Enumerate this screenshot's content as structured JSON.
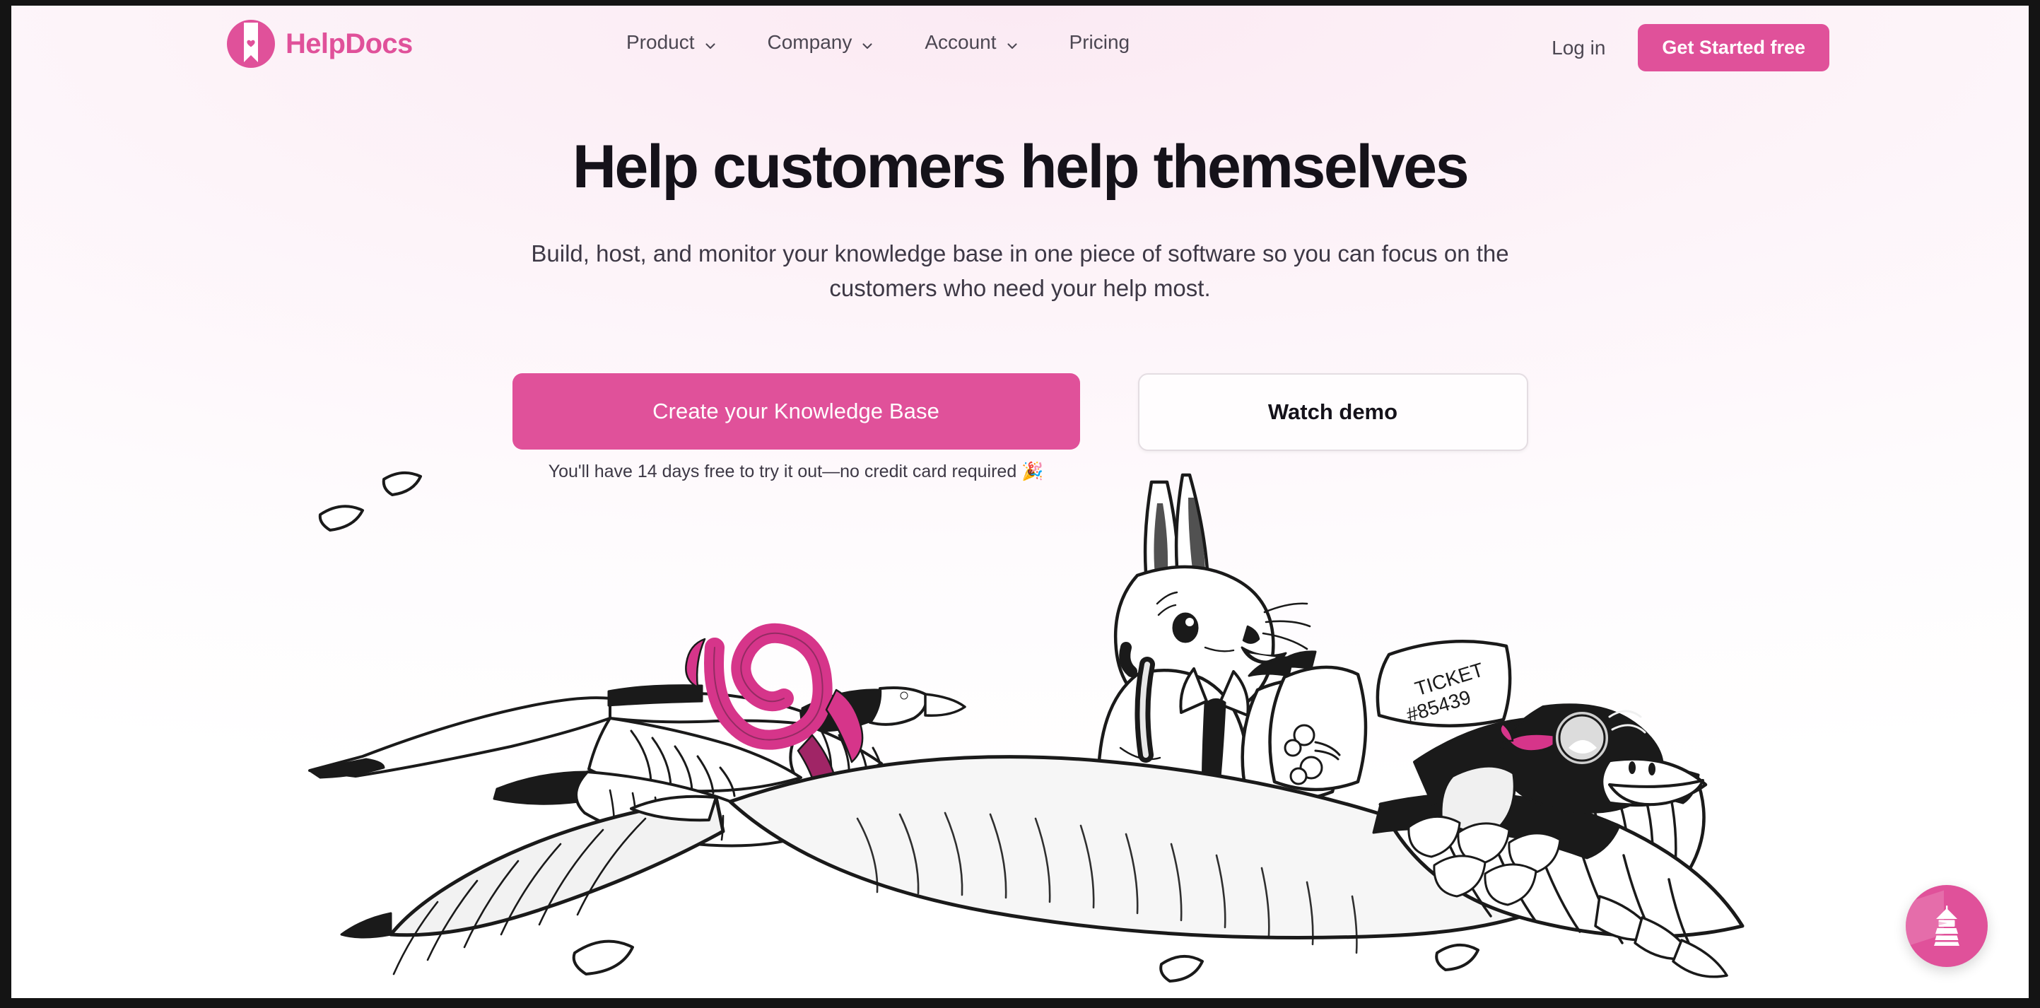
{
  "brand": {
    "name": "HelpDocs",
    "logo_icon": "helpdocs-bookmark-heart-logo",
    "accent_color": "#e0519a"
  },
  "header": {
    "nav_items": [
      {
        "label": "Product",
        "has_dropdown": true,
        "icon": "chevron-down-icon"
      },
      {
        "label": "Company",
        "has_dropdown": true,
        "icon": "chevron-down-icon"
      },
      {
        "label": "Account",
        "has_dropdown": true,
        "icon": "chevron-down-icon"
      },
      {
        "label": "Pricing",
        "has_dropdown": false,
        "icon": ""
      }
    ],
    "login_label": "Log in",
    "cta_label": "Get Started free"
  },
  "hero": {
    "title": "Help customers help themselves",
    "subtitle": "Build, host, and monitor your knowledge base in one piece of software so you can focus on the customers who need your help most.",
    "primary_cta": "Create your Knowledge Base",
    "secondary_cta": "Watch demo",
    "trial_note": "You'll have 14 days free to try it out—no credit card required 🎉"
  },
  "illustration": {
    "description": "Ink-style drawing of a rabbit riding a large flying goose wearing aviator goggles, with a second goose, a pink ribbon, and scattered papers",
    "ticket_label": "TICKET",
    "ticket_number": "#85439",
    "ribbon_color": "#e0519a",
    "goggle_strap_color": "#e0519a"
  },
  "chat_widget": {
    "icon": "lighthouse-icon",
    "background_color": "#e0519a"
  },
  "colors": {
    "accent_pink": "#e0519a",
    "page_background": "#fdf4f9",
    "text_dark": "#15121a",
    "text_muted": "#4c4752"
  }
}
